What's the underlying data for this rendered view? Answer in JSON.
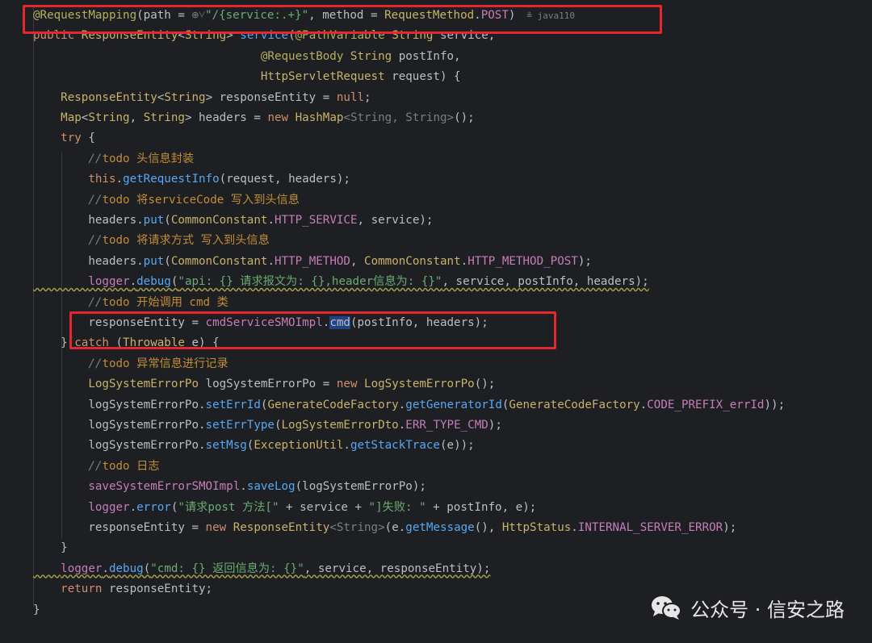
{
  "code_lines": [
    {
      "segs": [
        [
          "ann",
          "@RequestMapping"
        ],
        [
          "var",
          "(path = "
        ],
        [
          "muted",
          "⊕˅"
        ],
        [
          "str",
          "\"/{service:.+}\""
        ],
        [
          "var",
          ", method = "
        ],
        [
          "type",
          "RequestMethod"
        ],
        [
          "var",
          "."
        ],
        [
          "cst",
          "POST"
        ],
        [
          "var",
          ")"
        ]
      ],
      "hint": "≗ java110"
    },
    {
      "segs": [
        [
          "kw",
          "public "
        ],
        [
          "type",
          "ResponseEntity"
        ],
        [
          "var",
          "<"
        ],
        [
          "type",
          "String"
        ],
        [
          "var",
          "> "
        ],
        [
          "fn",
          "service"
        ],
        [
          "var",
          "("
        ],
        [
          "ann",
          "@PathVariable "
        ],
        [
          "type",
          "String "
        ],
        [
          "var",
          "service,"
        ]
      ]
    },
    {
      "segs": [
        [
          "var",
          "                                 "
        ],
        [
          "ann",
          "@RequestBody "
        ],
        [
          "type",
          "String "
        ],
        [
          "var",
          "postInfo,"
        ]
      ]
    },
    {
      "segs": [
        [
          "var",
          "                                 "
        ],
        [
          "type",
          "HttpServletRequest "
        ],
        [
          "var",
          "request) {"
        ]
      ]
    },
    {
      "segs": [
        [
          "var",
          "    "
        ],
        [
          "type",
          "ResponseEntity"
        ],
        [
          "var",
          "<"
        ],
        [
          "type",
          "String"
        ],
        [
          "var",
          "> responseEntity = "
        ],
        [
          "kw",
          "null"
        ],
        [
          "var",
          ";"
        ]
      ]
    },
    {
      "segs": [
        [
          "var",
          "    "
        ],
        [
          "type",
          "Map"
        ],
        [
          "var",
          "<"
        ],
        [
          "type",
          "String"
        ],
        [
          "var",
          ", "
        ],
        [
          "type",
          "String"
        ],
        [
          "var",
          "> headers = "
        ],
        [
          "kw",
          "new "
        ],
        [
          "type",
          "HashMap"
        ],
        [
          "muted",
          "<String, String>"
        ],
        [
          "var",
          "();"
        ]
      ]
    },
    {
      "segs": [
        [
          "var",
          "    "
        ],
        [
          "kw",
          "try "
        ],
        [
          "var",
          "{"
        ]
      ]
    },
    {
      "segs": [
        [
          "var",
          "        "
        ],
        [
          "cmt",
          "//"
        ],
        [
          "todo",
          "todo 头信息封装"
        ]
      ]
    },
    {
      "segs": [
        [
          "var",
          "        "
        ],
        [
          "kw",
          "this"
        ],
        [
          "var",
          "."
        ],
        [
          "fn",
          "getRequestInfo"
        ],
        [
          "var",
          "(request, headers);"
        ]
      ]
    },
    {
      "segs": [
        [
          "var",
          "        "
        ],
        [
          "cmt",
          "//"
        ],
        [
          "todo",
          "todo 将serviceCode 写入到头信息"
        ]
      ]
    },
    {
      "segs": [
        [
          "var",
          "        headers."
        ],
        [
          "fn",
          "put"
        ],
        [
          "var",
          "("
        ],
        [
          "type",
          "CommonConstant"
        ],
        [
          "var",
          "."
        ],
        [
          "cst",
          "HTTP_SERVICE"
        ],
        [
          "var",
          ", service);"
        ]
      ]
    },
    {
      "segs": [
        [
          "var",
          "        "
        ],
        [
          "cmt",
          "//"
        ],
        [
          "todo",
          "todo 将请求方式 写入到头信息"
        ]
      ]
    },
    {
      "segs": [
        [
          "var",
          "        headers."
        ],
        [
          "fn",
          "put"
        ],
        [
          "var",
          "("
        ],
        [
          "type",
          "CommonConstant"
        ],
        [
          "var",
          "."
        ],
        [
          "cst",
          "HTTP_METHOD"
        ],
        [
          "var",
          ", "
        ],
        [
          "type",
          "CommonConstant"
        ],
        [
          "var",
          "."
        ],
        [
          "cst",
          "HTTP_METHOD_POST"
        ],
        [
          "var",
          ");"
        ]
      ]
    },
    {
      "segs": [
        [
          "var",
          "        "
        ],
        [
          "fld",
          "logger"
        ],
        [
          "var",
          "."
        ],
        [
          "fn",
          "debug"
        ],
        [
          "var",
          "("
        ],
        [
          "str",
          "\"api: {} 请求报文为: {},header信息为: {}\""
        ],
        [
          "var",
          ", service, postInfo, headers);"
        ]
      ],
      "warn": true
    },
    {
      "segs": [
        [
          "var",
          "        "
        ],
        [
          "cmt",
          "//"
        ],
        [
          "todo",
          "todo 开始调用 cmd 类"
        ]
      ]
    },
    {
      "segs": [
        [
          "var",
          "        responseEntity = "
        ],
        [
          "fld",
          "cmdServiceSMOImpl"
        ],
        [
          "var",
          "."
        ],
        [
          "sel",
          "cmd"
        ],
        [
          "var",
          "(postInfo, headers);"
        ]
      ]
    },
    {
      "segs": [
        [
          "var",
          "    } "
        ],
        [
          "kw",
          "catch "
        ],
        [
          "var",
          "("
        ],
        [
          "type",
          "Throwable "
        ],
        [
          "var",
          "e) {"
        ]
      ]
    },
    {
      "segs": [
        [
          "var",
          "        "
        ],
        [
          "cmt",
          "//"
        ],
        [
          "todo",
          "todo 异常信息进行记录"
        ]
      ]
    },
    {
      "segs": [
        [
          "var",
          "        "
        ],
        [
          "type",
          "LogSystemErrorPo "
        ],
        [
          "var",
          "logSystemErrorPo = "
        ],
        [
          "kw",
          "new "
        ],
        [
          "type",
          "LogSystemErrorPo"
        ],
        [
          "var",
          "();"
        ]
      ]
    },
    {
      "segs": [
        [
          "var",
          "        logSystemErrorPo."
        ],
        [
          "fn",
          "setErrId"
        ],
        [
          "var",
          "("
        ],
        [
          "type",
          "GenerateCodeFactory"
        ],
        [
          "var",
          "."
        ],
        [
          "fn",
          "getGeneratorId"
        ],
        [
          "var",
          "("
        ],
        [
          "type",
          "GenerateCodeFactory"
        ],
        [
          "var",
          "."
        ],
        [
          "cst",
          "CODE_PREFIX_errId"
        ],
        [
          "var",
          "));"
        ]
      ]
    },
    {
      "segs": [
        [
          "var",
          "        logSystemErrorPo."
        ],
        [
          "fn",
          "setErrType"
        ],
        [
          "var",
          "("
        ],
        [
          "type",
          "LogSystemErrorDto"
        ],
        [
          "var",
          "."
        ],
        [
          "cst",
          "ERR_TYPE_CMD"
        ],
        [
          "var",
          ");"
        ]
      ]
    },
    {
      "segs": [
        [
          "var",
          "        logSystemErrorPo."
        ],
        [
          "fn",
          "setMsg"
        ],
        [
          "var",
          "("
        ],
        [
          "type",
          "ExceptionUtil"
        ],
        [
          "var",
          "."
        ],
        [
          "fn",
          "getStackTrace"
        ],
        [
          "var",
          "(e));"
        ]
      ]
    },
    {
      "segs": [
        [
          "var",
          "        "
        ],
        [
          "cmt",
          "//"
        ],
        [
          "todo",
          "todo 日志"
        ]
      ]
    },
    {
      "segs": [
        [
          "var",
          "        "
        ],
        [
          "fld",
          "saveSystemErrorSMOImpl"
        ],
        [
          "var",
          "."
        ],
        [
          "fn",
          "saveLog"
        ],
        [
          "var",
          "(logSystemErrorPo);"
        ]
      ]
    },
    {
      "segs": [
        [
          "var",
          "        "
        ],
        [
          "fld",
          "logger"
        ],
        [
          "var",
          "."
        ],
        [
          "fn",
          "error"
        ],
        [
          "var",
          "("
        ],
        [
          "str",
          "\"请求post 方法[\""
        ],
        [
          "var",
          " + service + "
        ],
        [
          "str",
          "\"]失败: \""
        ],
        [
          "var",
          " + postInfo, e);"
        ]
      ]
    },
    {
      "segs": [
        [
          "var",
          "        responseEntity = "
        ],
        [
          "kw",
          "new "
        ],
        [
          "type",
          "ResponseEntity"
        ],
        [
          "muted",
          "<String>"
        ],
        [
          "var",
          "(e."
        ],
        [
          "fn",
          "getMessage"
        ],
        [
          "var",
          "(), "
        ],
        [
          "type",
          "HttpStatus"
        ],
        [
          "var",
          "."
        ],
        [
          "cst",
          "INTERNAL_SERVER_ERROR"
        ],
        [
          "var",
          ");"
        ]
      ]
    },
    {
      "segs": [
        [
          "var",
          "    }"
        ]
      ]
    },
    {
      "segs": [
        [
          "var",
          "    "
        ],
        [
          "fld",
          "logger"
        ],
        [
          "var",
          "."
        ],
        [
          "fn",
          "debug"
        ],
        [
          "var",
          "("
        ],
        [
          "str",
          "\"cmd: {} 返回信息为: {}\""
        ],
        [
          "var",
          ", service, responseEntity);"
        ]
      ],
      "warn": true
    },
    {
      "segs": [
        [
          "var",
          "    "
        ],
        [
          "kw",
          "return "
        ],
        [
          "var",
          "responseEntity;"
        ]
      ]
    },
    {
      "segs": [
        [
          "var",
          "}"
        ]
      ]
    }
  ],
  "watermark": {
    "text": "公众号 · 信安之路",
    "icon": "wechat-icon"
  },
  "colors": {
    "background": "#1e1f22",
    "highlight_box": "#e5282f"
  }
}
